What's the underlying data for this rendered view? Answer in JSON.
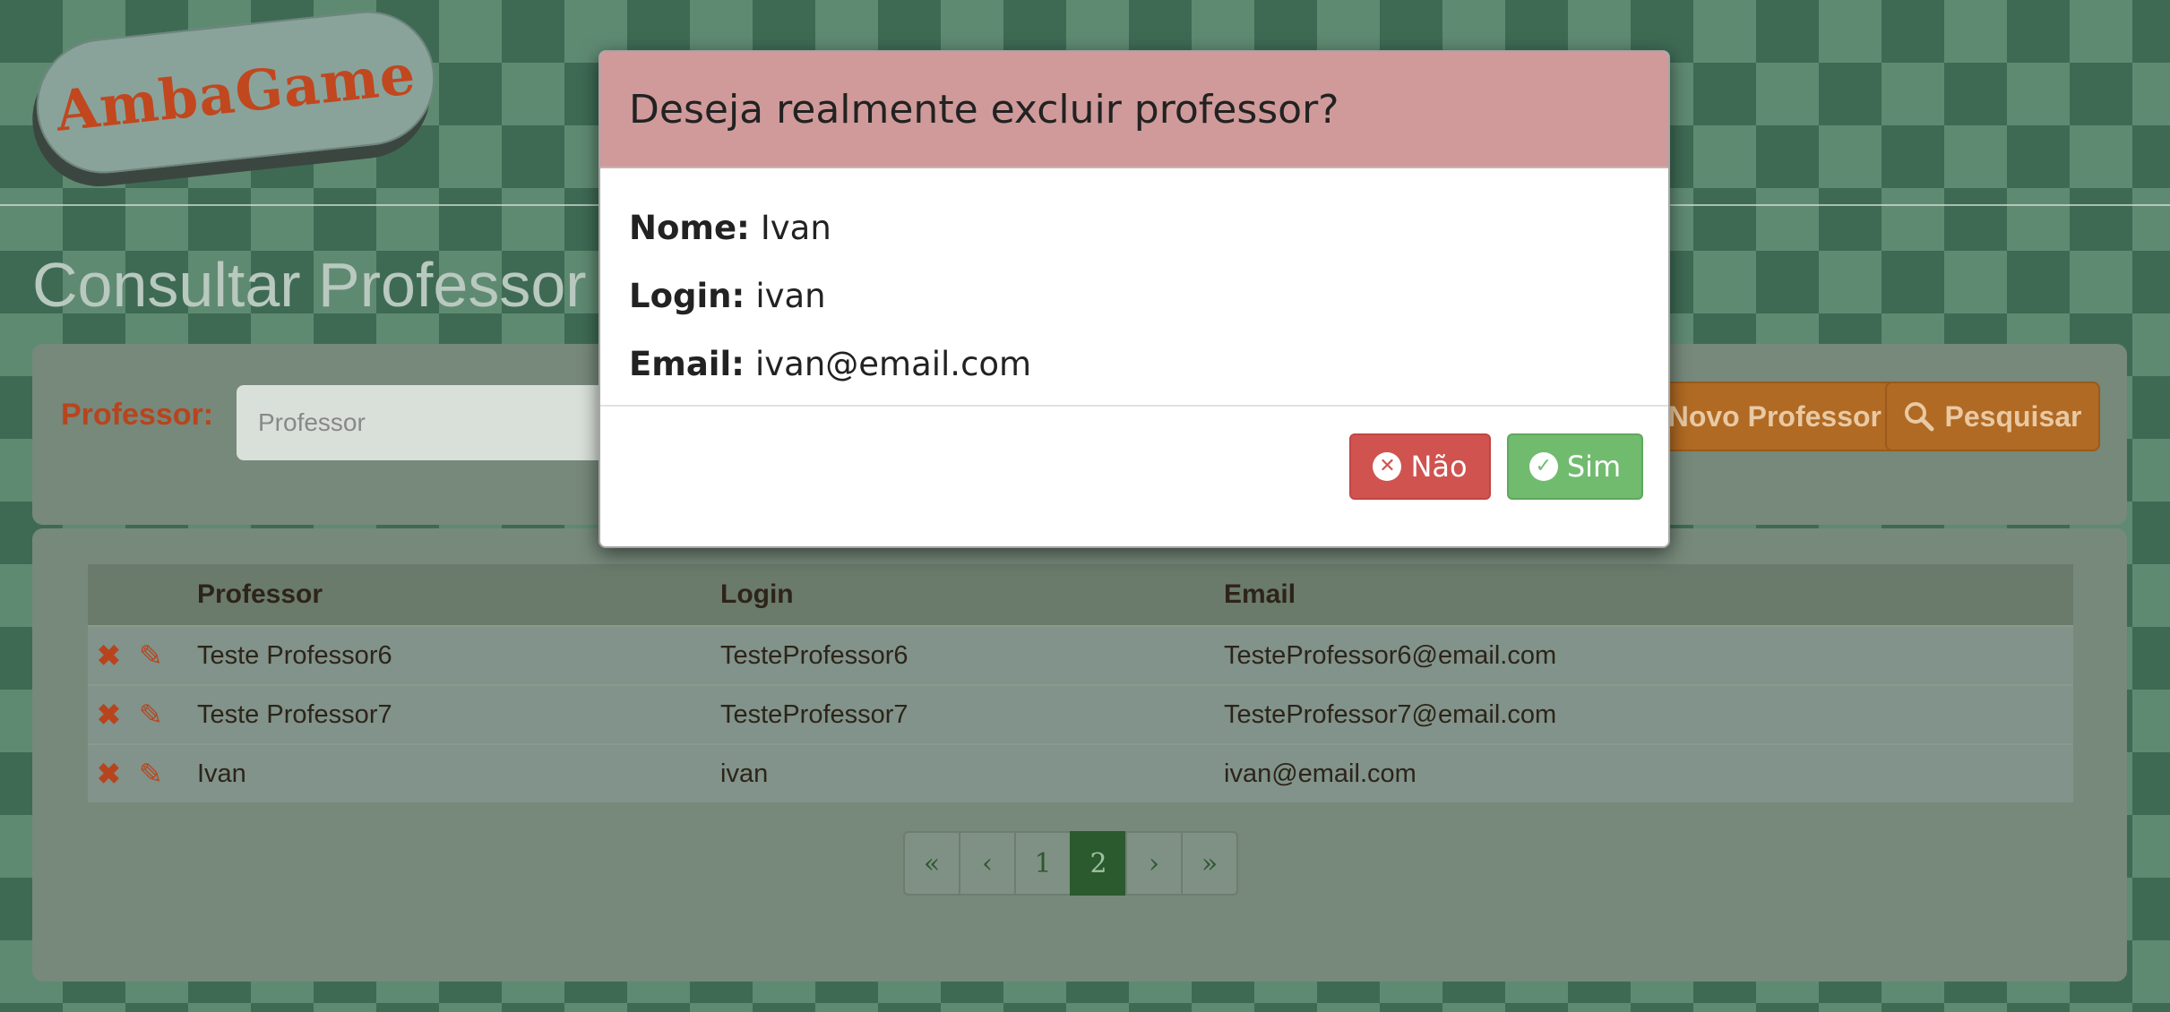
{
  "brand": {
    "logo": "AmbaGame"
  },
  "page": {
    "title": "Consultar Professor"
  },
  "search": {
    "label": "Professor:",
    "placeholder": "Professor",
    "new_button": "Novo Professor",
    "search_button": "Pesquisar"
  },
  "table": {
    "headers": [
      "Professor",
      "Login",
      "Email"
    ],
    "rows": [
      {
        "professor": "Teste Professor6",
        "login": "TesteProfessor6",
        "email": "TesteProfessor6@email.com"
      },
      {
        "professor": "Teste Professor7",
        "login": "TesteProfessor7",
        "email": "TesteProfessor7@email.com"
      },
      {
        "professor": "Ivan",
        "login": "ivan",
        "email": "ivan@email.com"
      }
    ]
  },
  "pagination": {
    "first": "«",
    "prev": "‹",
    "pages": [
      "1",
      "2"
    ],
    "active_page": "2",
    "next": "›",
    "last": "»"
  },
  "modal": {
    "title": "Deseja realmente excluir professor?",
    "fields": [
      {
        "label": "Nome:",
        "value": "Ivan"
      },
      {
        "label": "Login:",
        "value": "ivan"
      },
      {
        "label": "Email:",
        "value": "ivan@email.com"
      }
    ],
    "no_label": "Não",
    "yes_label": "Sim"
  },
  "icons": {
    "delete": "times-icon",
    "edit": "pencil-icon",
    "search": "search-icon",
    "no": "times-circle-icon",
    "yes": "check-circle-icon"
  },
  "colors": {
    "accent_orange": "#b06a23",
    "brand_red": "#c1471f",
    "modal_header": "#d09a9a",
    "danger": "#d05350",
    "success": "#71bb6f",
    "active_page": "#2a5a2e"
  }
}
